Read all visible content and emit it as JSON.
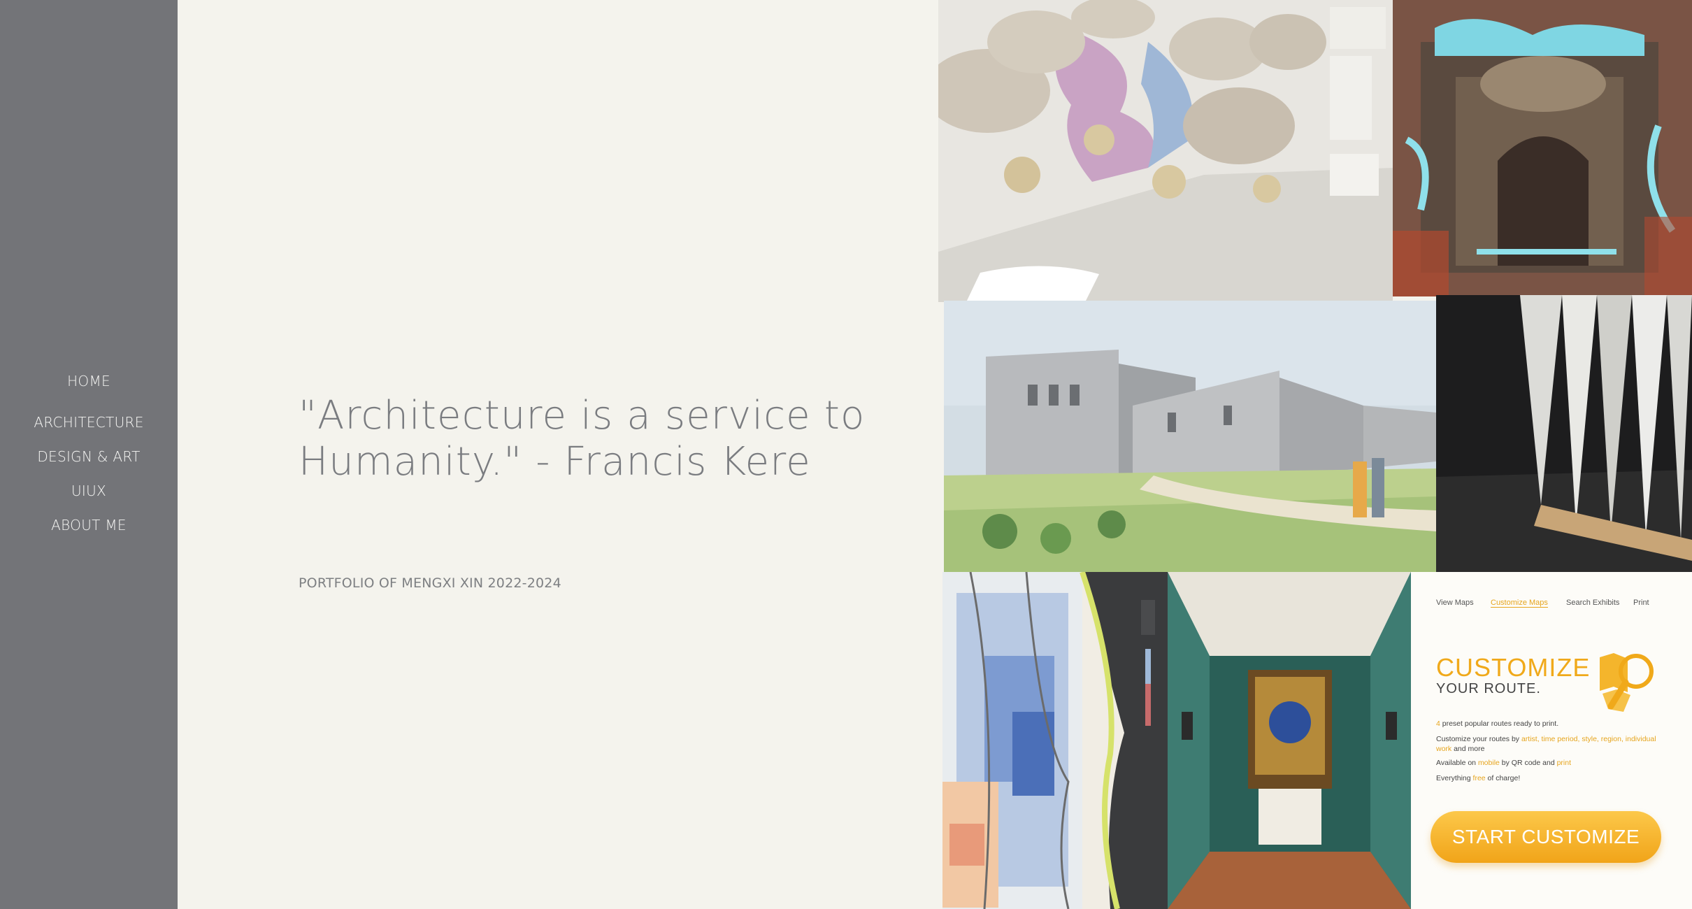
{
  "nav": {
    "items": [
      {
        "label": "HOME"
      },
      {
        "label": "ARCHITECTURE"
      },
      {
        "label": "DESIGN & ART"
      },
      {
        "label": "UIUX"
      },
      {
        "label": "ABOUT ME"
      }
    ]
  },
  "hero": {
    "quote_line1": "\"Architecture is a service to",
    "quote_line2": "Humanity.\" - Francis Kere",
    "subtitle": "PORTFOLIO OF MENGXI XIN 2022-2024"
  },
  "ui_panel": {
    "tabs": [
      "View Maps",
      "Customize Maps",
      "Search Exhibits",
      "Print"
    ],
    "active_tab": "Customize Maps",
    "heading": "CUSTOMIZE",
    "heading2": "YOUR ROUTE.",
    "line1_num": "4",
    "line1_rest": " preset popular routes ready to print.",
    "line2_pre": "Customize your routes by ",
    "line2_hl": "artist, time period, style, region, individual work",
    "line2_post": " and more",
    "line3_pre": "Available on ",
    "line3_hl1": "mobile",
    "line3_mid": " by QR code and ",
    "line3_hl2": "print",
    "line4_pre": "Everything ",
    "line4_hl": "free",
    "line4_post": " of charge!",
    "button": "START CUSTOMIZE"
  },
  "colors": {
    "sidebar": "#737478",
    "background": "#f4f3ed",
    "accent": "#f0a91a"
  }
}
